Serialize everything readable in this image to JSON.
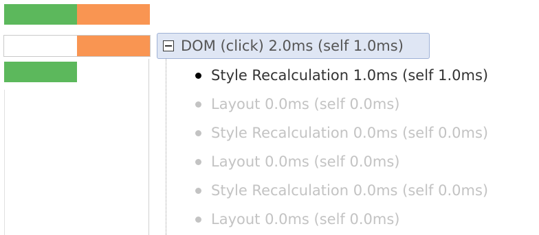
{
  "colors": {
    "scripting": "#5cb85c",
    "rendering": "#f99552",
    "selected_bg": "#dfe6f4",
    "selected_border": "#9fb1d6"
  },
  "tree": {
    "expander_icon": "collapse-minus-icon",
    "root_label": "DOM (click) 2.0ms (self 1.0ms)",
    "children": [
      {
        "label": "Style Recalculation 1.0ms (self 1.0ms)",
        "state": "active"
      },
      {
        "label": "Layout 0.0ms (self 0.0ms)",
        "state": "dim"
      },
      {
        "label": "Style Recalculation 0.0ms (self 0.0ms)",
        "state": "dim"
      },
      {
        "label": "Layout 0.0ms (self 0.0ms)",
        "state": "dim"
      },
      {
        "label": "Style Recalculation 0.0ms (self 0.0ms)",
        "state": "dim"
      },
      {
        "label": "Layout 0.0ms (self 0.0ms)",
        "state": "dim"
      }
    ]
  }
}
